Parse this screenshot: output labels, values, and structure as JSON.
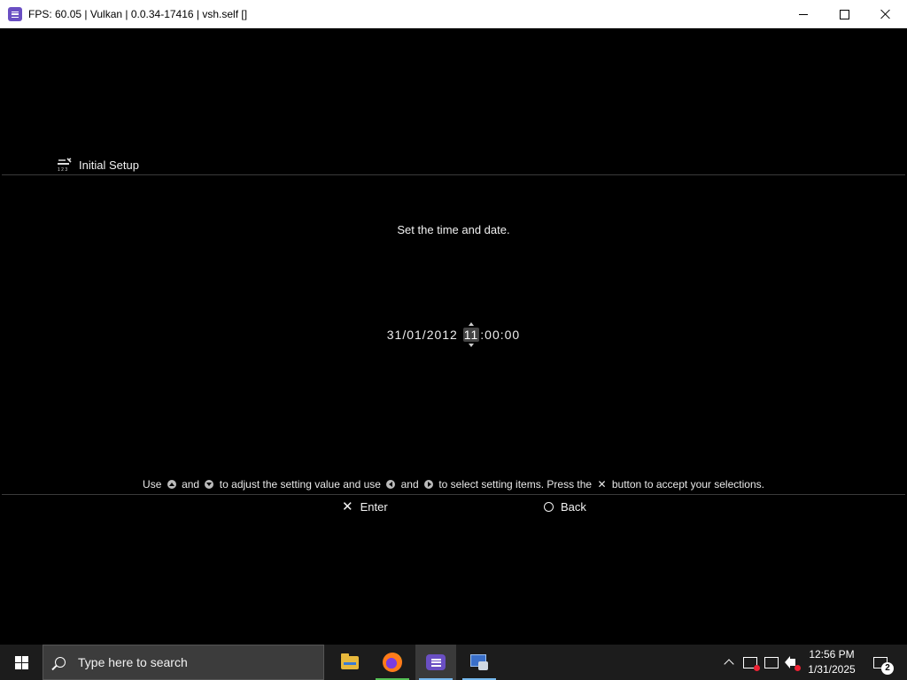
{
  "window": {
    "title": "FPS: 60.05 | Vulkan | 0.0.34-17416 | vsh.self []",
    "app_icon": "rpcs3-icon",
    "controls": {
      "minimize": "minimize-icon",
      "maximize": "maximize-icon",
      "close": "close-icon"
    }
  },
  "setup": {
    "header_title": "Initial Setup",
    "header_icon": "settings-tools-icon",
    "prompt": "Set the time and date.",
    "datetime": {
      "date": "31/01/2012",
      "hour": "11",
      "rest": ":00:00",
      "selected_field": "hour"
    },
    "instructions": {
      "p1": "Use",
      "and1": "and",
      "p2": "to adjust the setting value and use",
      "and2": "and",
      "p3": "to select setting items. Press the",
      "p4": "button to accept your selections."
    },
    "actions": {
      "enter": "Enter",
      "back": "Back"
    }
  },
  "taskbar": {
    "search_placeholder": "Type here to search",
    "apps": [
      "file-explorer-icon",
      "firefox-icon",
      "rpcs3-icon",
      "network-app-icon"
    ],
    "active_app": "rpcs3-icon",
    "tray": {
      "time": "12:56 PM",
      "date": "1/31/2025",
      "notification_count": "2"
    }
  }
}
